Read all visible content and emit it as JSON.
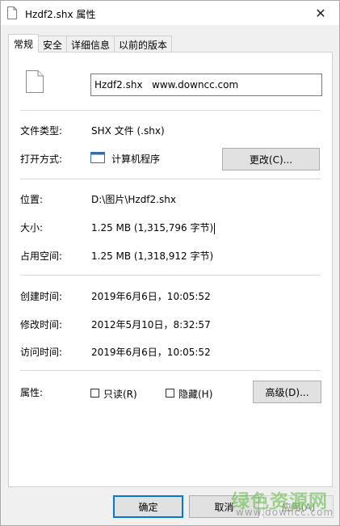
{
  "window": {
    "title": "Hzdf2.shx 属性",
    "close_glyph": "✕"
  },
  "tabs": [
    {
      "label": "常规",
      "active": true
    },
    {
      "label": "安全"
    },
    {
      "label": "详细信息"
    },
    {
      "label": "以前的版本"
    }
  ],
  "general": {
    "file_name": "Hzdf2.shx   www.downcc.com",
    "file_type_label": "文件类型:",
    "file_type_value": "SHX 文件 (.shx)",
    "open_with_label": "打开方式:",
    "open_with_value": "计算机程序",
    "change_button": "更改(C)...",
    "location_label": "位置:",
    "location_value": "D:\\图片\\Hzdf2.shx",
    "size_label": "大小:",
    "size_value": "1.25 MB (1,315,796 字节)",
    "size_on_disk_label": "占用空间:",
    "size_on_disk_value": "1.25 MB (1,318,912 字节)",
    "created_label": "创建时间:",
    "created_value": "2019年6月6日，10:05:52",
    "modified_label": "修改时间:",
    "modified_value": "2012年5月10日，8:32:57",
    "accessed_label": "访问时间:",
    "accessed_value": "2019年6月6日，10:05:52",
    "attributes_label": "属性:",
    "readonly_label": "只读(R)",
    "hidden_label": "隐藏(H)",
    "advanced_button": "高级(D)..."
  },
  "footer": {
    "ok": "确定",
    "cancel": "取消",
    "apply": "应用(A)"
  },
  "watermark": {
    "chinese": "绿色资源网",
    "url": "www.downcc.com"
  },
  "colors": {
    "accent": "#0078d7",
    "watermark_green": "#5cba3c"
  }
}
